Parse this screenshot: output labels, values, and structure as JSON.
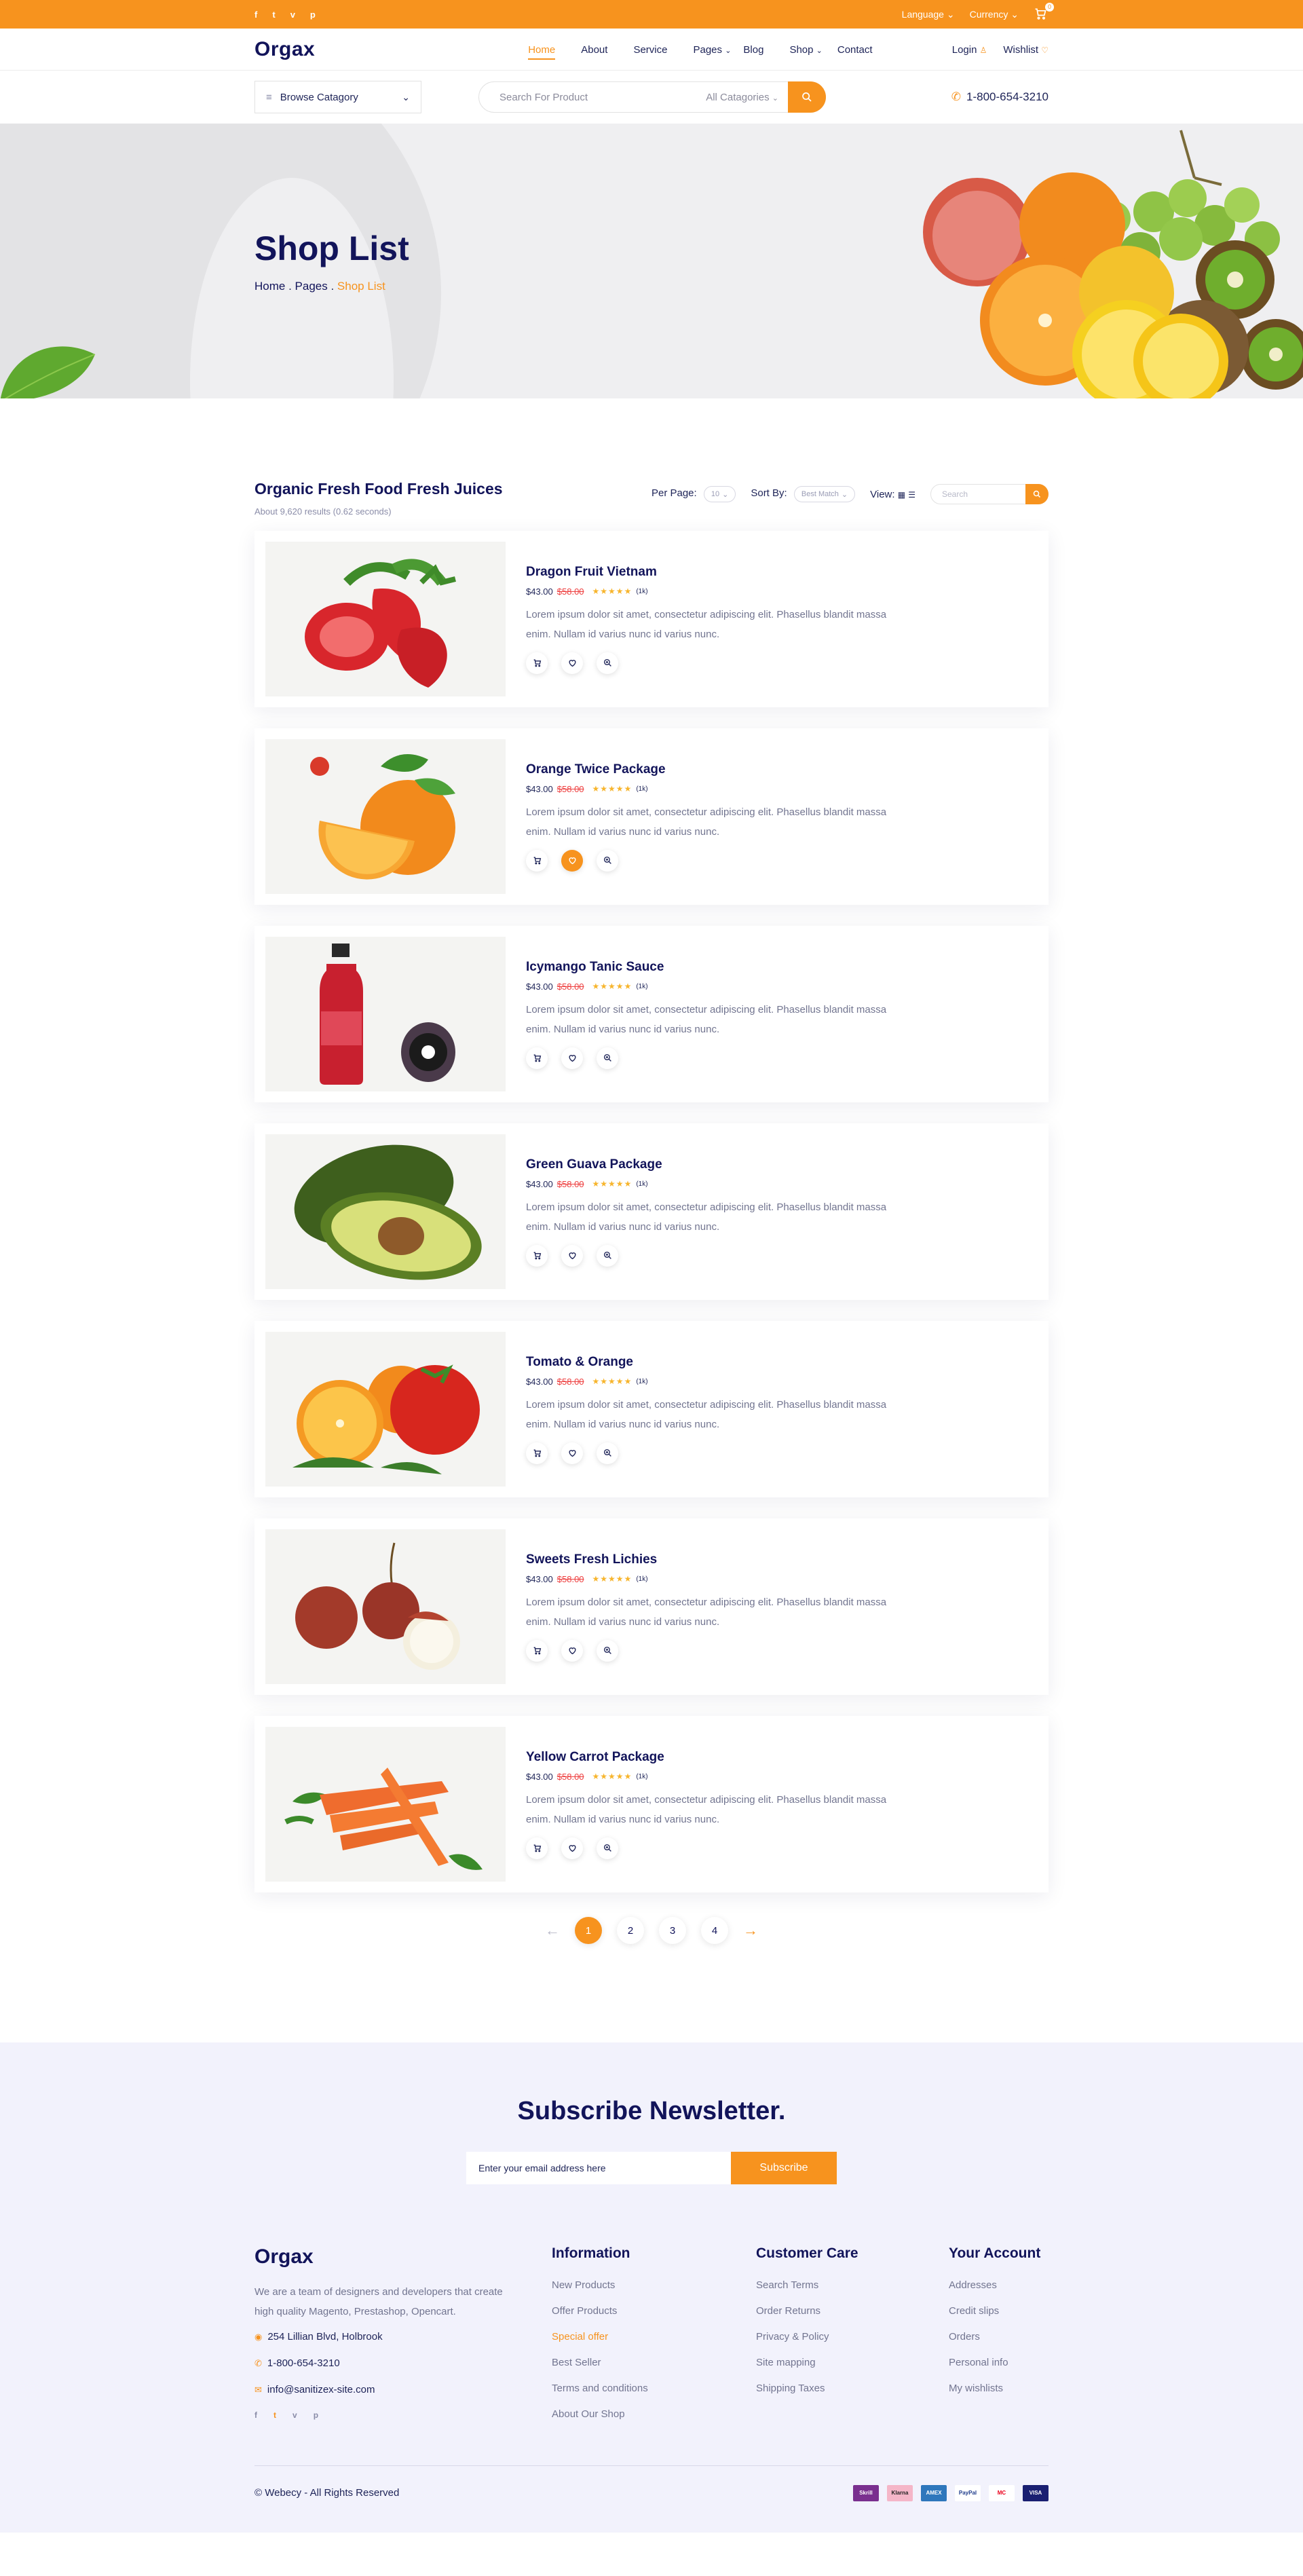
{
  "topbar": {
    "social": [
      "f",
      "t",
      "v",
      "p"
    ],
    "language": "Language",
    "currency": "Currency",
    "cart_count": "0"
  },
  "header": {
    "logo": "Orgax",
    "nav": [
      "Home",
      "About",
      "Service",
      "Pages",
      "Blog",
      "Shop",
      "Contact"
    ],
    "login": "Login",
    "wishlist": "Wishlist"
  },
  "search": {
    "browse": "Browse Catagory",
    "placeholder": "Search For Product",
    "category": "All Catagories",
    "phone": "1-800-654-3210"
  },
  "hero": {
    "title": "Shop List",
    "crumb_home": "Home",
    "crumb_pages": "Pages",
    "crumb_current": "Shop List"
  },
  "listing": {
    "heading": "Organic Fresh Food Fresh Juices",
    "results": "About 9,620 results (0.62 seconds)",
    "per_page_label": "Per Page:",
    "per_page_value": "10",
    "sort_label": "Sort By:",
    "sort_value": "Best Match",
    "view_label": "View:",
    "search_placeholder": "Search"
  },
  "products": [
    {
      "title": "Dragon Fruit Vietnam",
      "price": "$43.00",
      "old_price": "$58.00",
      "stars": "★★★★★",
      "count": "(1k)",
      "desc": "Lorem ipsum dolor sit amet, consectetur adipiscing elit. Phasellus blandit massa enim. Nullam id varius nunc id varius nunc.",
      "image": "strawberries"
    },
    {
      "title": "Orange Twice Package",
      "price": "$43.00",
      "old_price": "$58.00",
      "stars": "★★★★★",
      "count": "(1k)",
      "desc": "Lorem ipsum dolor sit amet, consectetur adipiscing elit. Phasellus blandit massa enim. Nullam id varius nunc id varius nunc.",
      "image": "oranges"
    },
    {
      "title": "Icymango Tanic Sauce",
      "price": "$43.00",
      "old_price": "$58.00",
      "stars": "★★★★★",
      "count": "(1k)",
      "desc": "Lorem ipsum dolor sit amet, consectetur adipiscing elit. Phasellus blandit massa enim. Nullam id varius nunc id varius nunc.",
      "image": "juice-bottle"
    },
    {
      "title": "Green Guava Package",
      "price": "$43.00",
      "old_price": "$58.00",
      "stars": "★★★★★",
      "count": "(1k)",
      "desc": "Lorem ipsum dolor sit amet, consectetur adipiscing elit. Phasellus blandit massa enim. Nullam id varius nunc id varius nunc.",
      "image": "avocado"
    },
    {
      "title": "Tomato & Orange",
      "price": "$43.00",
      "old_price": "$58.00",
      "stars": "★★★★★",
      "count": "(1k)",
      "desc": "Lorem ipsum dolor sit amet, consectetur adipiscing elit. Phasellus blandit massa enim. Nullam id varius nunc id varius nunc.",
      "image": "tomato-orange"
    },
    {
      "title": "Sweets Fresh Lichies",
      "price": "$43.00",
      "old_price": "$58.00",
      "stars": "★★★★★",
      "count": "(1k)",
      "desc": "Lorem ipsum dolor sit amet, consectetur adipiscing elit. Phasellus blandit massa enim. Nullam id varius nunc id varius nunc.",
      "image": "lychees"
    },
    {
      "title": "Yellow Carrot Package",
      "price": "$43.00",
      "old_price": "$58.00",
      "stars": "★★★★★",
      "count": "(1k)",
      "desc": "Lorem ipsum dolor sit amet, consectetur adipiscing elit. Phasellus blandit massa enim. Nullam id varius nunc id varius nunc.",
      "image": "carrots"
    }
  ],
  "pagination": {
    "prev": "←",
    "pages": [
      "1",
      "2",
      "3",
      "4"
    ],
    "current": "1",
    "next": "→"
  },
  "newsletter": {
    "title": "Subscribe Newsletter.",
    "placeholder": "Enter your email address here",
    "button": "Subscribe"
  },
  "footer": {
    "logo": "Orgax",
    "about": "We are a team of designers and developers that create high quality Magento, Prestashop, Opencart.",
    "address": "254 Lillian Blvd, Holbrook",
    "phone": "1-800-654-3210",
    "email": "info@sanitizex-site.com",
    "social": [
      "f",
      "t",
      "v",
      "p"
    ],
    "information": {
      "title": "Information",
      "links": [
        "New Products",
        "Offer Products",
        "Special offer",
        "Best Seller",
        "Terms and conditions",
        "About Our Shop"
      ]
    },
    "customer_care": {
      "title": "Customer Care",
      "links": [
        "Search Terms",
        "Order Returns",
        "Privacy & Policy",
        "Site mapping",
        "Shipping Taxes"
      ]
    },
    "account": {
      "title": "Your Account",
      "links": [
        "Addresses",
        "Credit slips",
        "Orders",
        "Personal info",
        "My wishlists"
      ]
    },
    "copyright": "© Webecy - All Rights Reserved",
    "payments": [
      "Skrill",
      "Klarna",
      "AMEX",
      "PayPal",
      "MC",
      "VISA"
    ]
  },
  "colors": {
    "accent": "#f7931e",
    "navy": "#12145a",
    "footer_bg": "#f2f2fc"
  }
}
